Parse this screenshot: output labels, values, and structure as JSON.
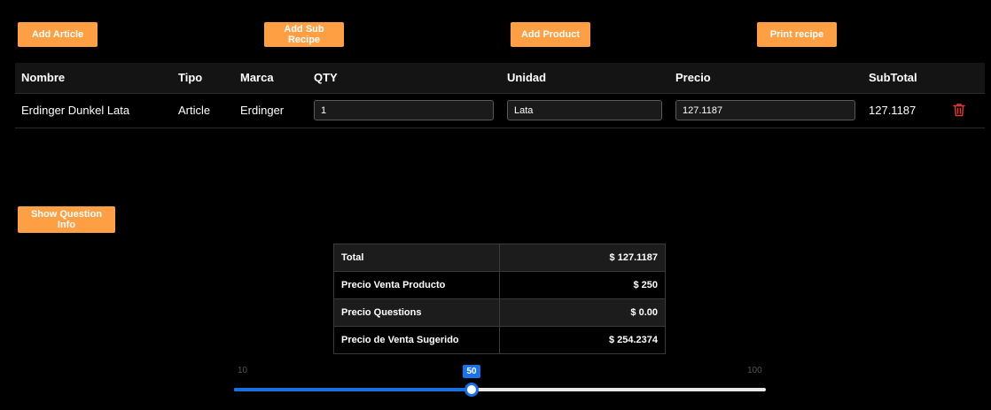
{
  "toolbar": {
    "add_article": "Add Article",
    "add_sub_recipe": "Add Sub Recipe",
    "add_product": "Add Product",
    "print_recipe": "Print recipe"
  },
  "table": {
    "headers": [
      "Nombre",
      "Tipo",
      "Marca",
      "QTY",
      "Unidad",
      "Precio",
      "SubTotal"
    ],
    "rows": [
      {
        "nombre": "Erdinger Dunkel Lata",
        "tipo": "Article",
        "marca": "Erdinger",
        "qty": "1",
        "unidad": "Lata",
        "precio": "127.1187",
        "subtotal": "127.1187",
        "delete_icon": "trash-icon"
      }
    ]
  },
  "question_button": "Show Question Info",
  "summary": [
    {
      "label": "Total",
      "value": "$ 127.1187"
    },
    {
      "label": "Precio Venta Producto",
      "value": "$ 250"
    },
    {
      "label": "Precio Questions",
      "value": "$ 0.00"
    },
    {
      "label": "Precio de Venta Sugerido",
      "value": "$ 254.2374"
    }
  ],
  "slider": {
    "min": "10",
    "max": "100",
    "value": 50,
    "value_label": "50"
  },
  "colors": {
    "accent": "#ff9f43",
    "slider": "#1a6fe0",
    "delete": "#e53935",
    "background": "#000000"
  }
}
